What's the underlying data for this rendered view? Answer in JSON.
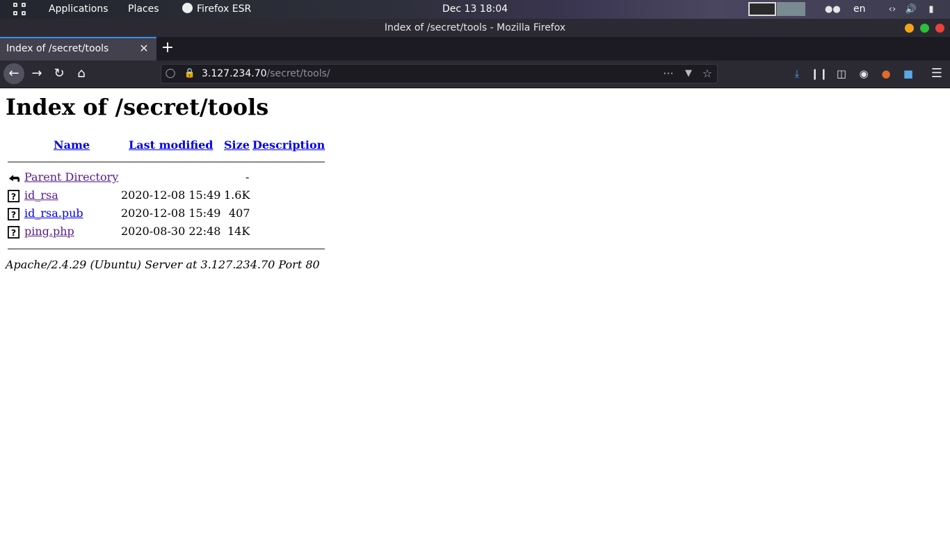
{
  "topbar": {
    "applications": "Applications",
    "places": "Places",
    "app_name": "Firefox ESR",
    "datetime": "Dec 13  18:04",
    "language": "en"
  },
  "window": {
    "title": "Index of /secret/tools - Mozilla Firefox"
  },
  "tabs": [
    {
      "label": "Index of /secret/tools"
    }
  ],
  "urlbar": {
    "host": "3.127.234.70",
    "path": "/secret/tools/"
  },
  "page": {
    "heading": "Index of /secret/tools",
    "columns": {
      "name": "Name",
      "last_modified": "Last modified",
      "size": "Size",
      "description": "Description"
    },
    "rows": [
      {
        "name": "Parent Directory",
        "modified": "",
        "size": "-",
        "icon": "back-arrow-icon"
      },
      {
        "name": "id_rsa",
        "modified": "2020-12-08 15:49",
        "size": "1.6K",
        "icon": "unknown-file-icon"
      },
      {
        "name": "id_rsa.pub",
        "modified": "2020-12-08 15:49",
        "size": "407",
        "icon": "unknown-file-icon"
      },
      {
        "name": "ping.php",
        "modified": "2020-08-30 22:48",
        "size": "14K",
        "icon": "unknown-file-icon"
      }
    ],
    "footer": "Apache/2.4.29 (Ubuntu) Server at 3.127.234.70 Port 80"
  },
  "colors": {
    "link": "#0000ee",
    "visited": "#551a8b",
    "tab_accent": "#3a8ee6",
    "close_dot": "#e9413c",
    "max_dot": "#2ebd3b",
    "min_dot": "#f2a419"
  }
}
